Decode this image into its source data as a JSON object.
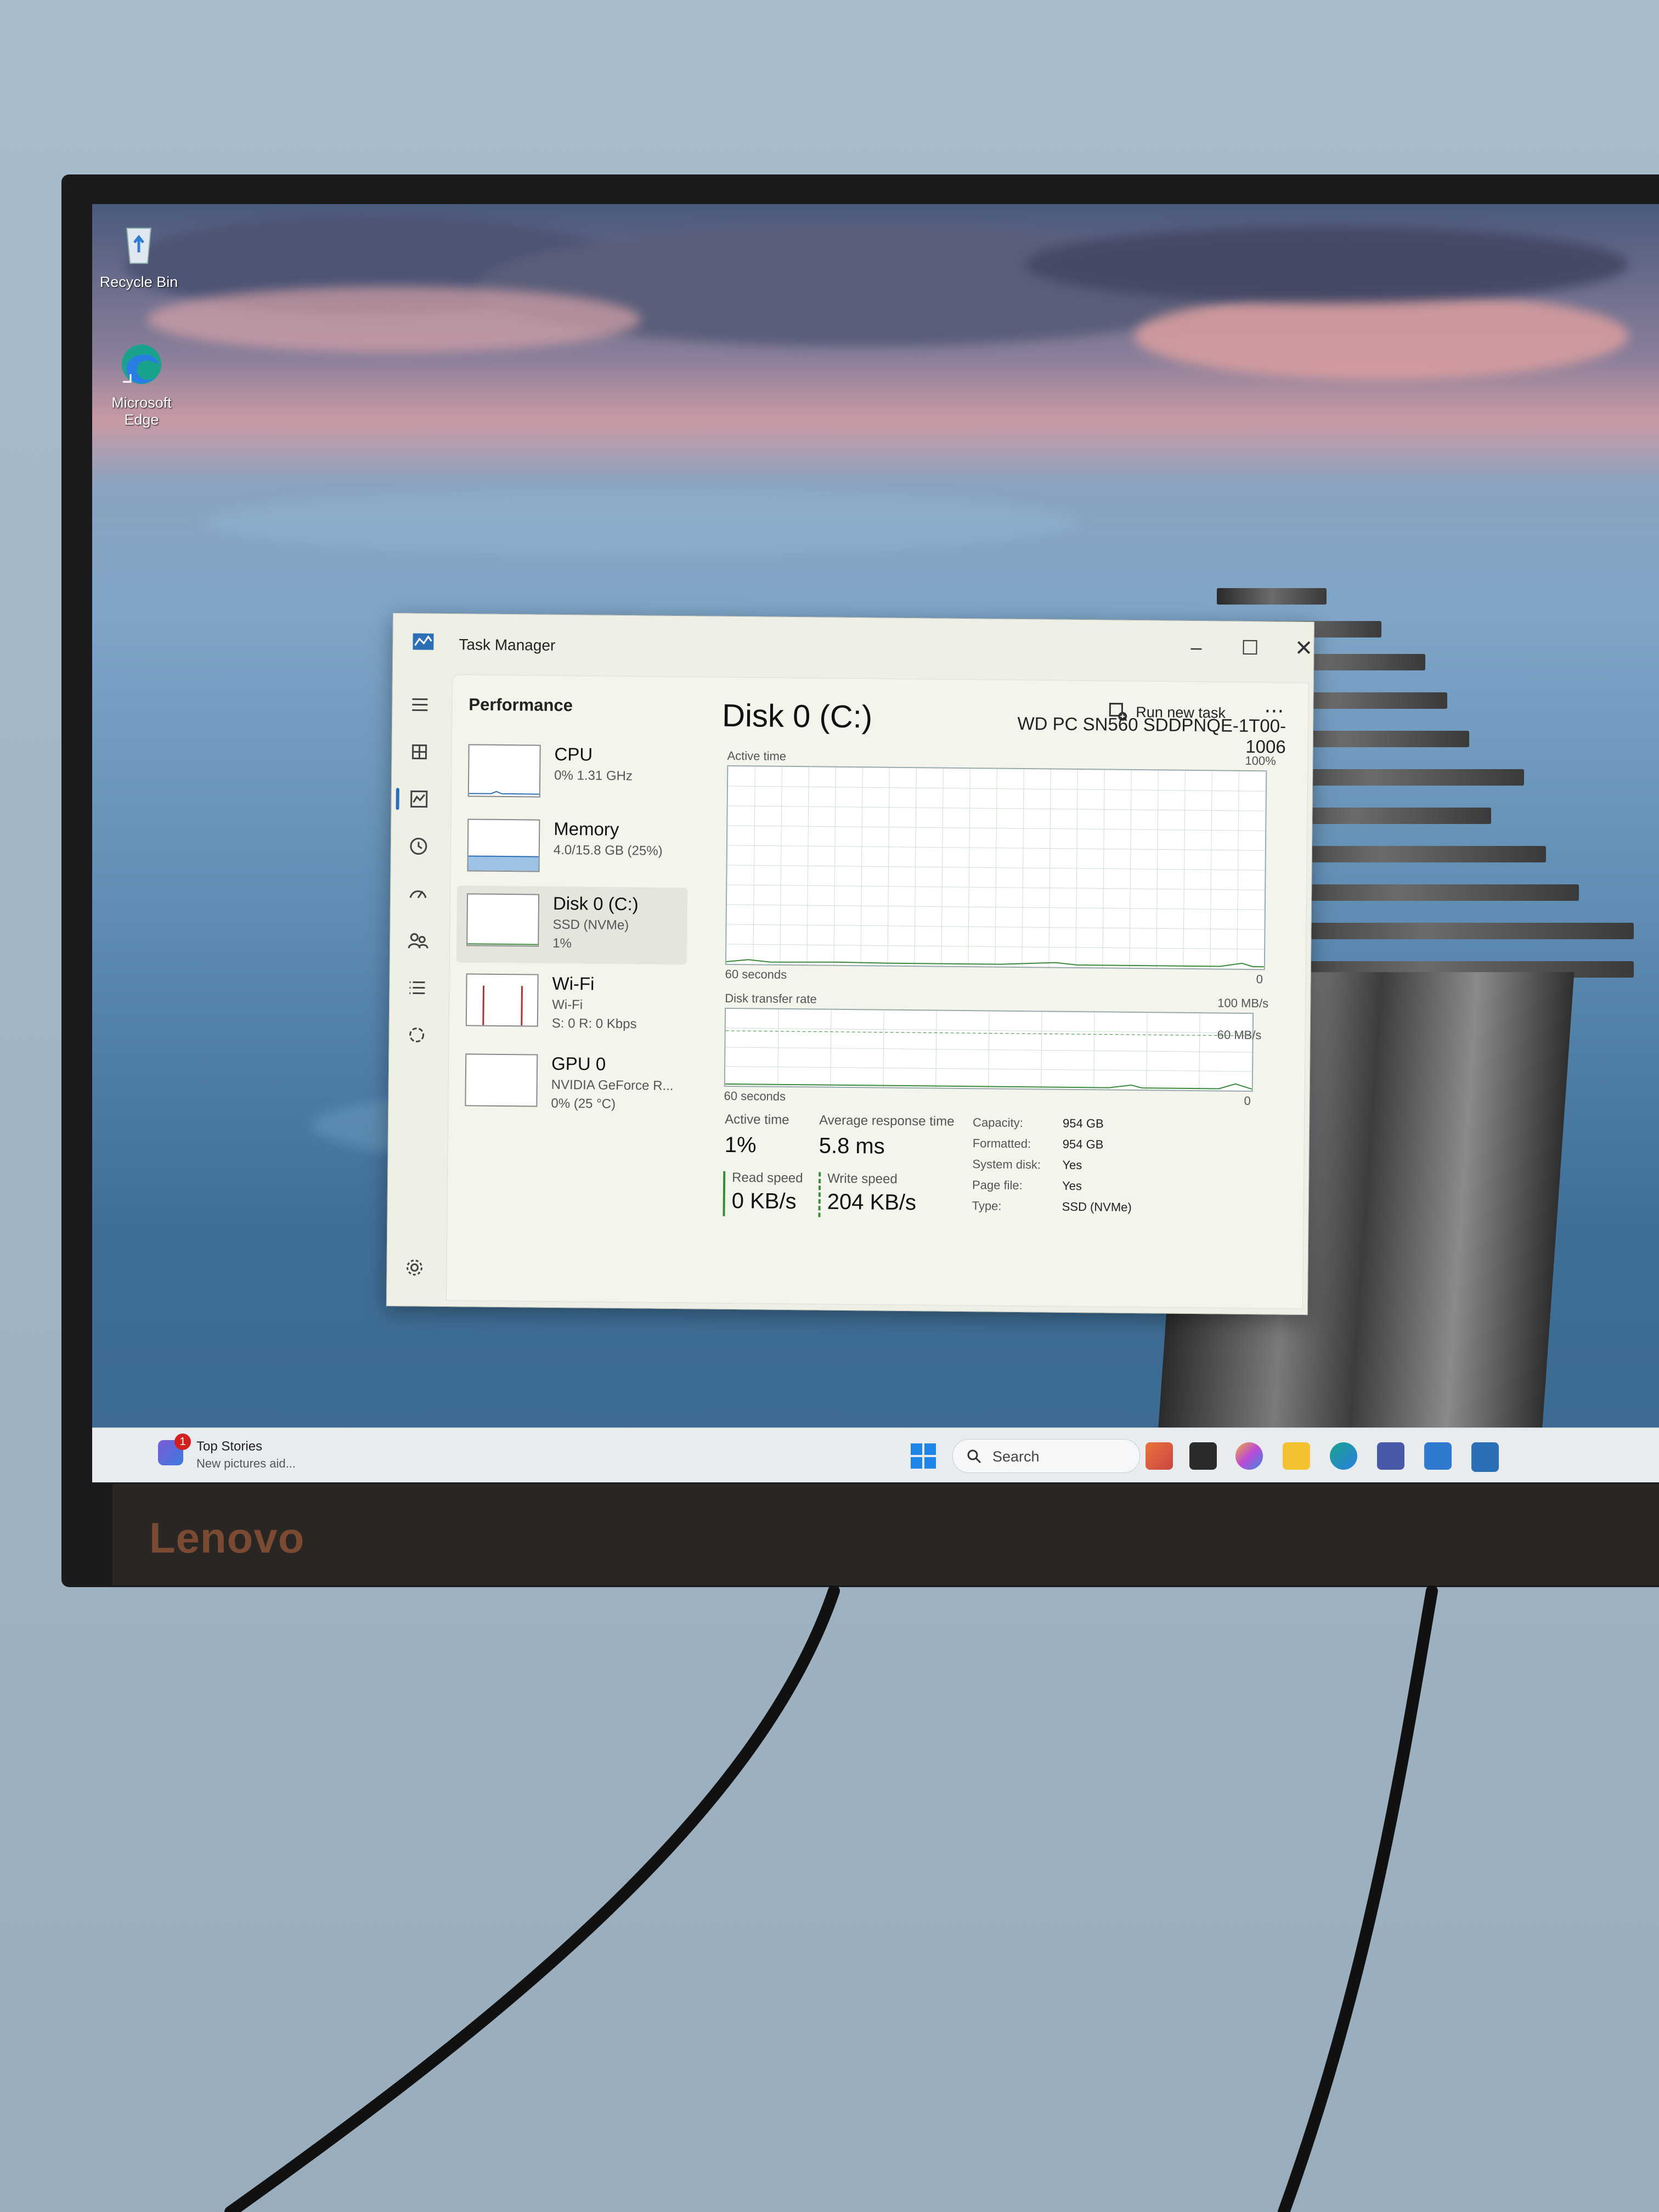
{
  "desktop": {
    "icons": [
      {
        "label": "Recycle Bin"
      },
      {
        "label": "Microsoft Edge"
      }
    ]
  },
  "task_manager": {
    "title": "Task Manager",
    "page": "Performance",
    "run_new_task": "Run new task",
    "devices": [
      {
        "name": "CPU",
        "lines": [
          "0% 1.31 GHz"
        ]
      },
      {
        "name": "Memory",
        "lines": [
          "4.0/15.8 GB (25%)"
        ]
      },
      {
        "name": "Disk 0 (C:)",
        "lines": [
          "SSD (NVMe)",
          "1%"
        ]
      },
      {
        "name": "Wi-Fi",
        "lines": [
          "Wi-Fi",
          "S: 0 R: 0 Kbps"
        ]
      },
      {
        "name": "GPU 0",
        "lines": [
          "NVIDIA GeForce R...",
          "0% (25 °C)"
        ]
      }
    ],
    "detail": {
      "title": "Disk 0 (C:)",
      "model": "WD PC SN560 SDDPNQE-1T00-1006",
      "graph1": {
        "label": "Active time",
        "max": "100%",
        "time": "60 seconds",
        "min": "0"
      },
      "graph2": {
        "label": "Disk transfer rate",
        "max": "100 MB/s",
        "mid": "60 MB/s",
        "time": "60 seconds",
        "min": "0"
      },
      "stats": {
        "active_time_label": "Active time",
        "active_time": "1%",
        "avg_response_label": "Average response time",
        "avg_response": "5.8 ms",
        "read_speed_label": "Read speed",
        "read_speed": "0 KB/s",
        "write_speed_label": "Write speed",
        "write_speed": "204 KB/s"
      },
      "properties": [
        {
          "label": "Capacity:",
          "value": "954 GB"
        },
        {
          "label": "Formatted:",
          "value": "954 GB"
        },
        {
          "label": "System disk:",
          "value": "Yes"
        },
        {
          "label": "Page file:",
          "value": "Yes"
        },
        {
          "label": "Type:",
          "value": "SSD (NVMe)"
        }
      ]
    }
  },
  "taskbar": {
    "news_badge": "1",
    "news_title": "Top Stories",
    "news_sub": "New pictures aid...",
    "search_placeholder": "Search"
  },
  "monitor": {
    "brand": "Lenovo"
  }
}
